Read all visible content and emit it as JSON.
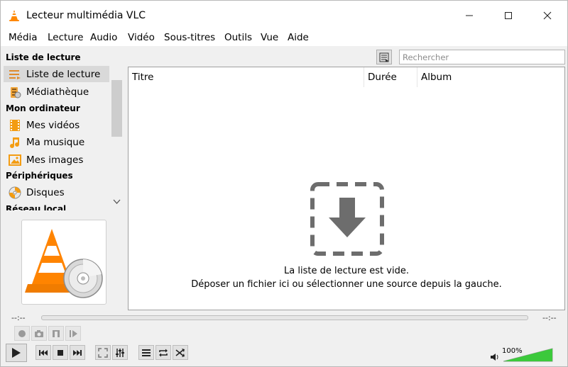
{
  "window": {
    "title": "Lecteur multimédia VLC",
    "minimize_glyph": "—",
    "maximize_glyph": "☐",
    "close_glyph": "✕"
  },
  "menu": [
    "Média",
    "Lecture",
    "Audio",
    "Vidéo",
    "Sous-titres",
    "Outils",
    "Vue",
    "Aide"
  ],
  "sidebar": {
    "sections": [
      {
        "title": "Liste de lecture"
      },
      {
        "title": "Mon ordinateur"
      },
      {
        "title": "Périphériques"
      },
      {
        "title": "Réseau local"
      }
    ],
    "items": [
      {
        "label": "Liste de lecture",
        "icon": "playlist-icon",
        "selected": true
      },
      {
        "label": "Médiathèque",
        "icon": "media-library-icon"
      },
      {
        "label": "Mes vidéos",
        "icon": "film-icon"
      },
      {
        "label": "Ma musique",
        "icon": "music-note-icon"
      },
      {
        "label": "Mes images",
        "icon": "image-icon"
      },
      {
        "label": "Disques",
        "icon": "disc-icon"
      }
    ],
    "scroll_down_glyph": "⌄"
  },
  "playlist": {
    "search_placeholder": "Rechercher",
    "columns": [
      "Titre",
      "Durée",
      "Album"
    ],
    "empty_line1": "La liste de lecture est vide.",
    "empty_line2": "Déposer un fichier ici ou sélectionner une source depuis la gauche."
  },
  "seek": {
    "elapsed": "--:--",
    "remaining": "--:--"
  },
  "volume": {
    "label": "100%",
    "level": 1.0
  },
  "colors": {
    "accent": "#ff8800",
    "volume_green": "#3cc93c"
  }
}
